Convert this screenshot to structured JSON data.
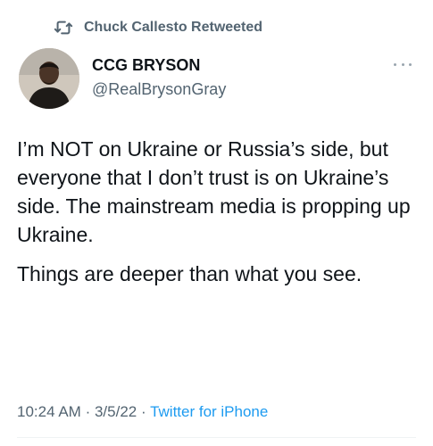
{
  "retweet": {
    "icon": "retweet-icon",
    "label": "Chuck Callesto Retweeted"
  },
  "author": {
    "display_name": "CCG BRYSON",
    "handle": "@RealBrysonGray"
  },
  "tweet": {
    "paragraphs": [
      "I’m NOT on Ukraine or Russia’s side, but everyone that I don’t trust is on Ukraine’s side. The mainstream media is propping up Ukraine.",
      "Things are deeper than what you see."
    ],
    "time": "10:24 AM",
    "separator": "·",
    "date": "3/5/22",
    "source": "Twitter for iPhone"
  },
  "colors": {
    "text": "#0f1419",
    "secondary": "#536471",
    "link": "#1d9bf0"
  }
}
